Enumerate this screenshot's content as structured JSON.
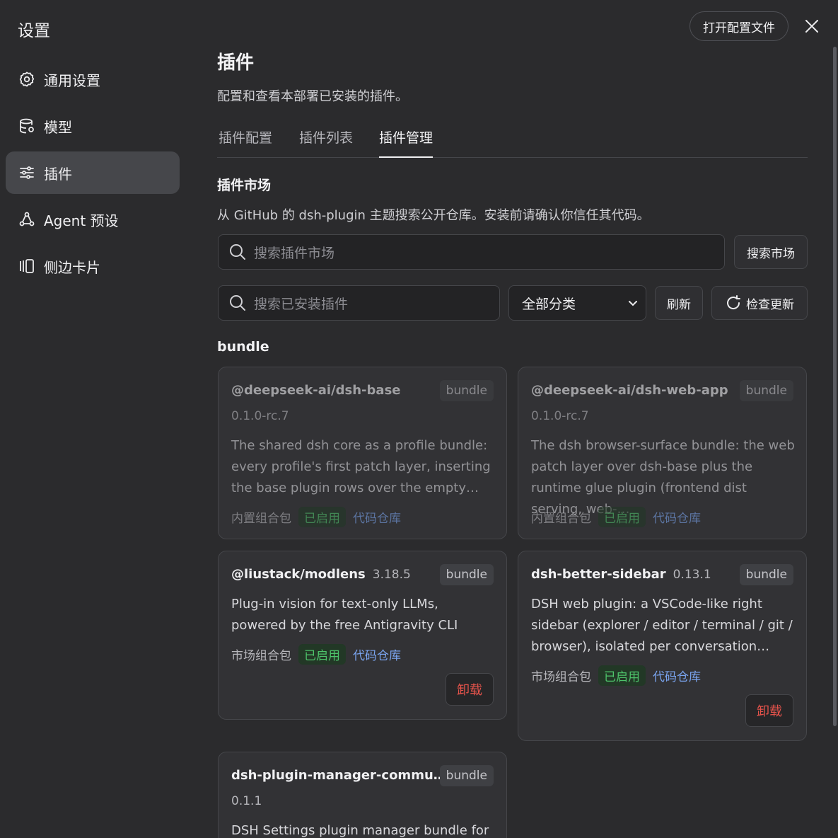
{
  "sidebar": {
    "title": "设置",
    "items": [
      {
        "label": "通用设置",
        "icon": "gear-icon"
      },
      {
        "label": "模型",
        "icon": "database-icon"
      },
      {
        "label": "插件",
        "icon": "sliders-icon"
      },
      {
        "label": "Agent 预设",
        "icon": "agent-icon"
      },
      {
        "label": "侧边卡片",
        "icon": "cards-icon"
      }
    ],
    "active_index": 2
  },
  "header": {
    "open_config_label": "打开配置文件",
    "close_icon": "close-icon"
  },
  "main": {
    "title": "插件",
    "description": "配置和查看本部署已安装的插件。",
    "tabs": [
      {
        "label": "插件配置"
      },
      {
        "label": "插件列表"
      },
      {
        "label": "插件管理"
      }
    ],
    "active_tab": 2,
    "market": {
      "title": "插件市场",
      "description": "从 GitHub 的 dsh-plugin 主题搜索公开仓库。安装前请确认你信任其代码。",
      "search_placeholder": "搜索插件市场",
      "search_button": "搜索市场"
    },
    "installed": {
      "search_placeholder": "搜索已安装插件",
      "category_selected": "全部分类",
      "refresh_button": "刷新",
      "check_updates_button": "检查更新"
    },
    "group_title": "bundle",
    "plugins": [
      {
        "name": "@deepseek-ai/dsh-base",
        "version": "0.1.0-rc.7",
        "badge": "bundle",
        "description": "The shared dsh core as a profile bundle: every profile's first patch layer, inserting the base plugin rows over the empty…",
        "source": "内置组合包",
        "status": "已启用",
        "repo": "代码仓库"
      },
      {
        "name": "@deepseek-ai/dsh-web-app",
        "version": "0.1.0-rc.7",
        "badge": "bundle",
        "description": "The dsh browser-surface bundle: the web patch layer over dsh-base plus the runtime glue plugin (frontend dist serving, web-…",
        "source": "内置组合包",
        "status": "已启用",
        "repo": "代码仓库"
      },
      {
        "name": "@liustack/modlens",
        "version": "3.18.5",
        "badge": "bundle",
        "description": "Plug-in vision for text-only LLMs, powered by the free Antigravity CLI",
        "source": "市场组合包",
        "status": "已启用",
        "repo": "代码仓库",
        "uninstall": "卸载"
      },
      {
        "name": "dsh-better-sidebar",
        "version": "0.13.1",
        "badge": "bundle",
        "description": "DSH web plugin: a VSCode-like right sidebar (explorer / editor / terminal / git / browser), isolated per conversation…",
        "source": "市场组合包",
        "status": "已启用",
        "repo": "代码仓库",
        "uninstall": "卸载"
      },
      {
        "name": "dsh-plugin-manager-commu…",
        "version": "0.1.1",
        "badge": "bundle",
        "description": "DSH Settings plugin manager bundle for"
      }
    ]
  },
  "colors": {
    "background": "#2b2b2d",
    "card": "#323235",
    "enabled_green": "#4ec46b",
    "link_blue": "#7aa4ef",
    "danger_red": "#e5534b"
  }
}
